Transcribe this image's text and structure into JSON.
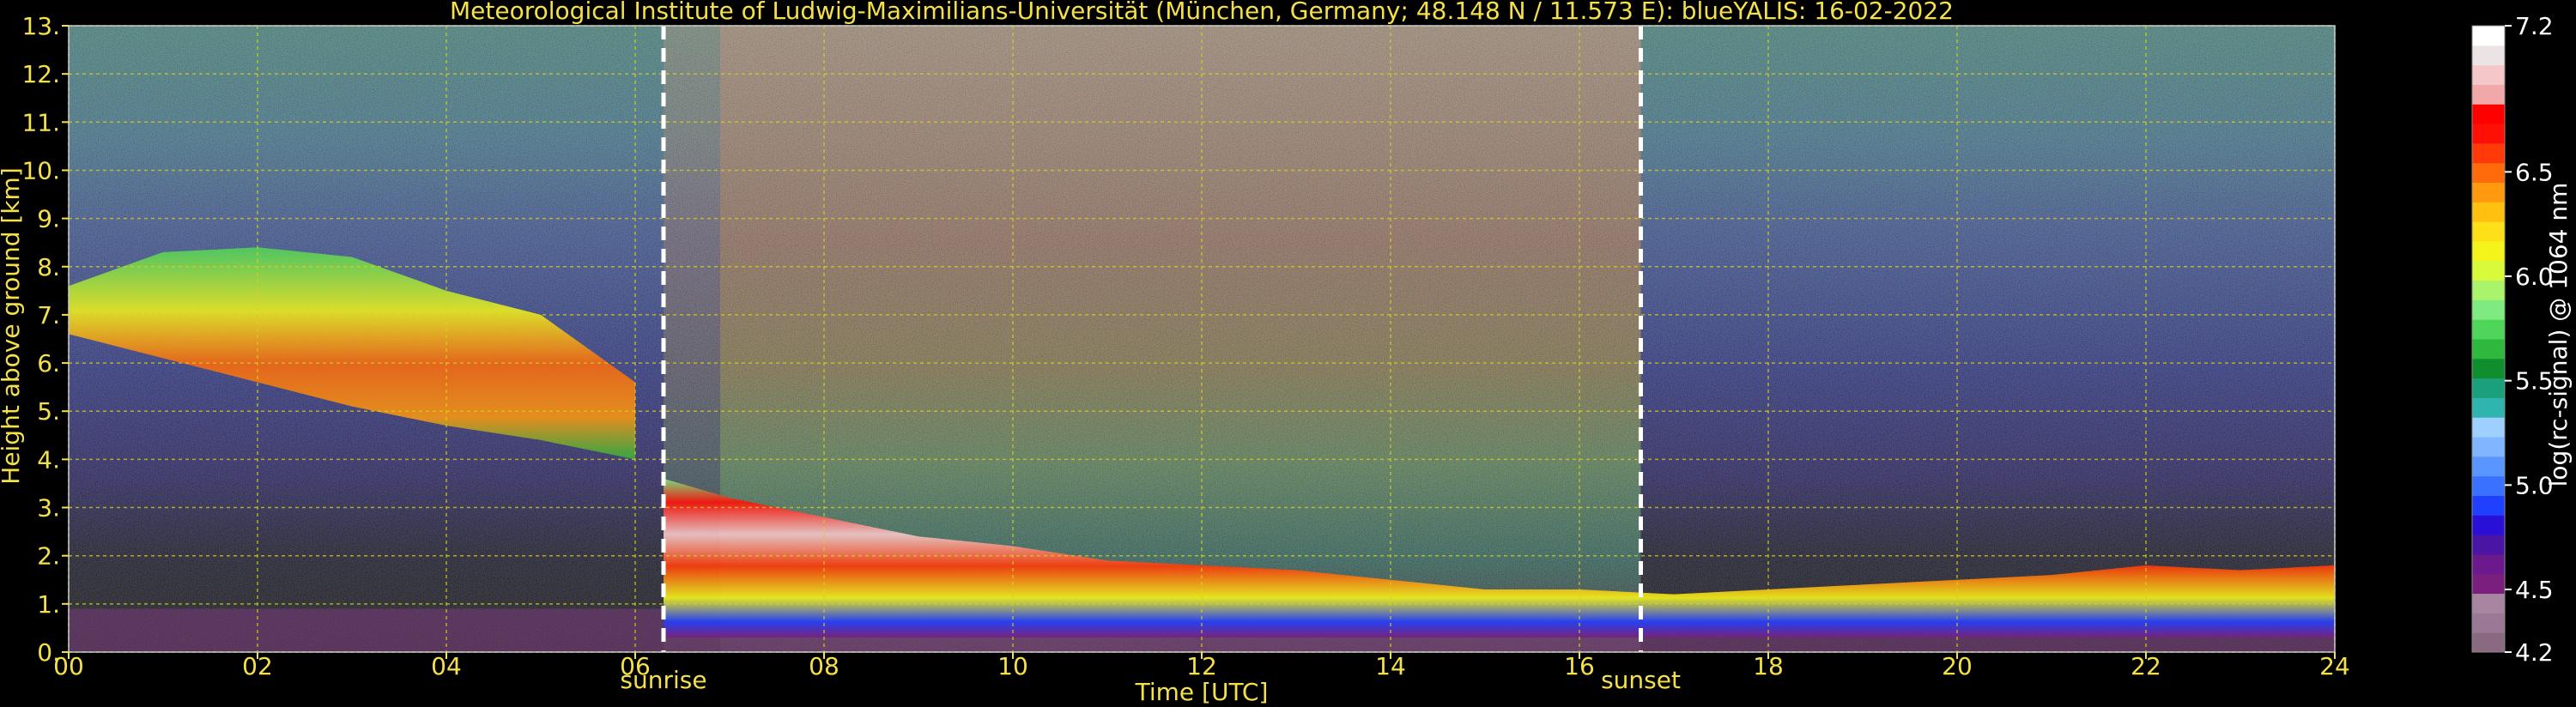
{
  "chart_data": {
    "type": "heatmap",
    "title": "Meteorological Institute of Ludwig-Maximilians-Universität (München, Germany; 48.148 N / 11.573 E):     blueYALIS: 16-02-2022",
    "xlabel": "Time [UTC]",
    "ylabel": "Height above ground [km]",
    "xlim": [
      0,
      24
    ],
    "ylim": [
      0,
      13
    ],
    "x_ticks": [
      "00",
      "02",
      "04",
      "06",
      "08",
      "10",
      "12",
      "14",
      "16",
      "18",
      "20",
      "22",
      "24"
    ],
    "y_ticks": [
      "0.",
      "1.",
      "2.",
      "3.",
      "4.",
      "5.",
      "6.",
      "7.",
      "8.",
      "9.",
      "10.",
      "11.",
      "12.",
      "13."
    ],
    "grid": true,
    "markers": [
      {
        "label": "sunrise",
        "x": 6.3
      },
      {
        "label": "sunset",
        "x": 16.65
      }
    ],
    "colorbar": {
      "label": "log(rc-signal) @ 1064 nm",
      "range": [
        4.2,
        7.2
      ],
      "ticks": [
        "4.2",
        "4.5",
        "5.0",
        "5.5",
        "6.0",
        "6.5",
        "7.2"
      ],
      "colors": [
        "#8a6a80",
        "#9b7896",
        "#a886a2",
        "#7a1f7e",
        "#6a1a8c",
        "#4a14a4",
        "#2a10d6",
        "#2040ff",
        "#3a72ff",
        "#5a96ff",
        "#7fb6ff",
        "#9fcfff",
        "#2fb4b0",
        "#1aa07a",
        "#108d2c",
        "#2fb83e",
        "#4fd65a",
        "#7fea7f",
        "#a9f46a",
        "#d8fa3a",
        "#f4f41a",
        "#fde018",
        "#ffc010",
        "#ff9a0e",
        "#ff6a0a",
        "#ff3a08",
        "#ff1006",
        "#ff0000",
        "#f0a8a8",
        "#f4c8c8",
        "#ece4e4",
        "#ffffff"
      ]
    },
    "features": [
      {
        "layer": "cirrus band",
        "t": [
          0,
          1,
          2,
          3,
          4,
          5,
          6
        ],
        "bottom_km": [
          6.6,
          6.1,
          5.6,
          5.1,
          4.7,
          4.4,
          4.0
        ],
        "top_km": [
          7.6,
          8.3,
          8.4,
          8.2,
          7.5,
          7.0,
          5.6
        ]
      },
      {
        "layer": "aerosol layer top",
        "t": [
          6.3,
          7,
          8,
          9,
          10,
          11,
          12,
          13,
          14,
          15,
          16,
          17,
          18,
          19,
          20,
          21,
          22,
          23,
          24
        ],
        "top_km": [
          3.6,
          3.2,
          2.8,
          2.4,
          2.2,
          1.9,
          1.8,
          1.7,
          1.5,
          1.3,
          1.3,
          1.2,
          1.3,
          1.4,
          1.5,
          1.6,
          1.8,
          1.7,
          1.8
        ]
      }
    ]
  }
}
